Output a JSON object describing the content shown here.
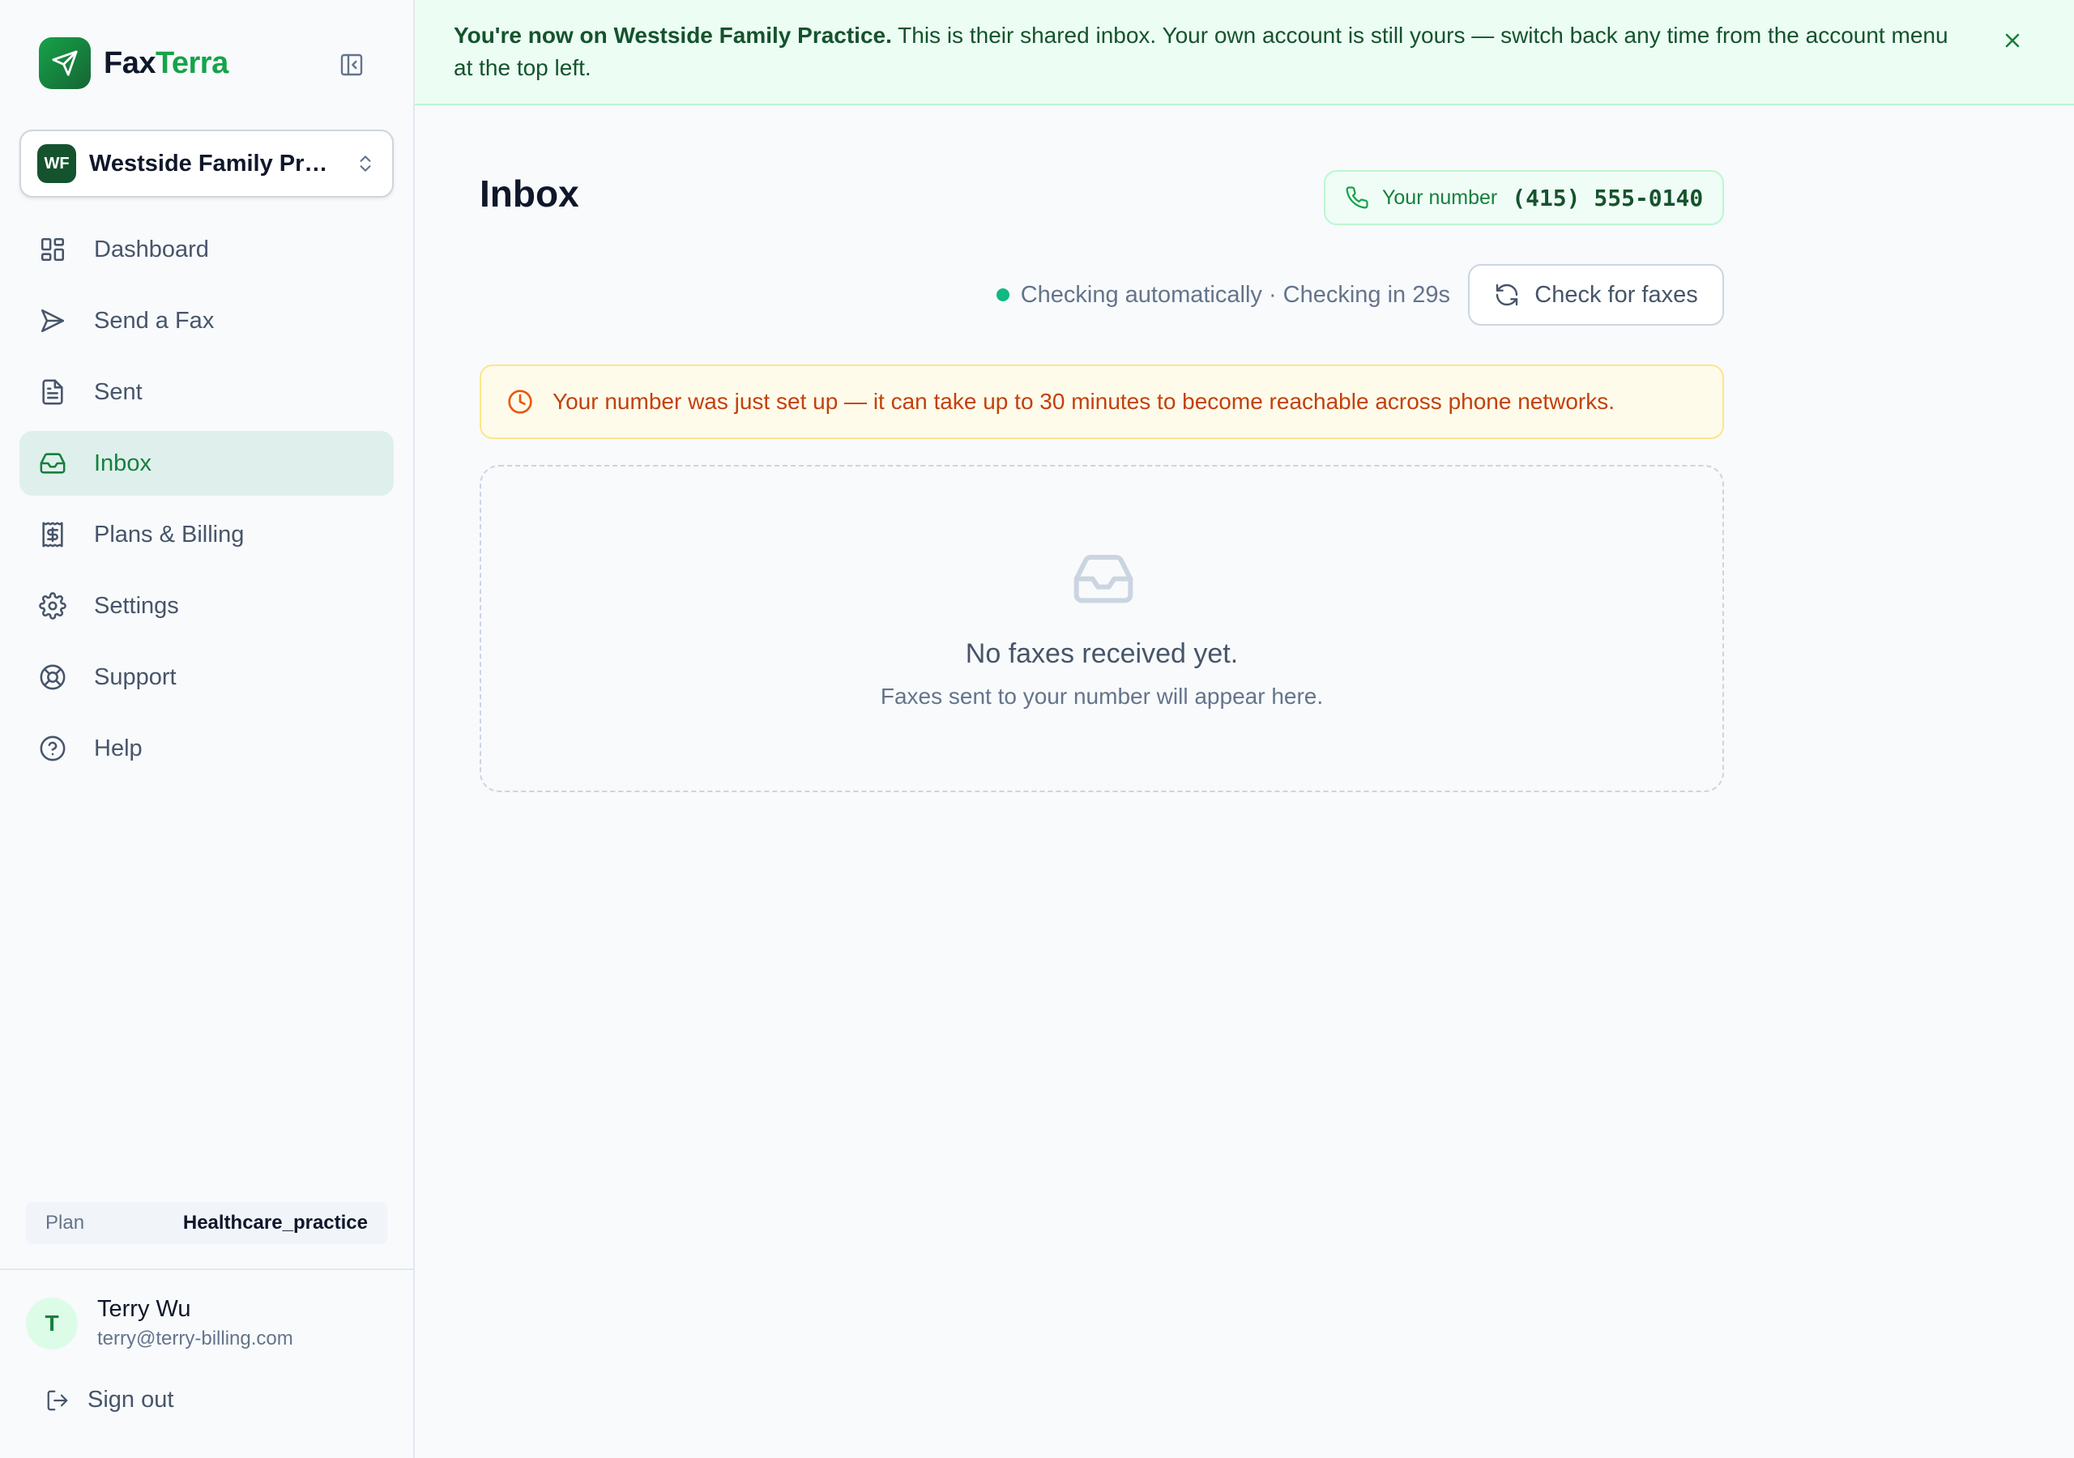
{
  "app": {
    "brand_part1": "Fax",
    "brand_part2": "Terra",
    "brand_color": "#16a34a"
  },
  "account": {
    "initials": "WF",
    "name": "Westside Family Practice"
  },
  "nav": {
    "items": [
      {
        "label": "Dashboard",
        "icon": "dashboard-icon"
      },
      {
        "label": "Send a Fax",
        "icon": "send-icon"
      },
      {
        "label": "Sent",
        "icon": "document-icon"
      },
      {
        "label": "Inbox",
        "icon": "inbox-icon",
        "active": true
      },
      {
        "label": "Plans & Billing",
        "icon": "billing-icon"
      },
      {
        "label": "Settings",
        "icon": "gear-icon"
      },
      {
        "label": "Support",
        "icon": "lifebuoy-icon"
      },
      {
        "label": "Help",
        "icon": "help-icon"
      }
    ]
  },
  "plan": {
    "label": "Plan",
    "value": "Healthcare_practice"
  },
  "user": {
    "initial": "T",
    "name": "Terry Wu",
    "email": "terry@terry-billing.com",
    "signout_label": "Sign out"
  },
  "banner": {
    "bold": "You're now on Westside Family Practice.",
    "text": " This is their shared inbox. Your own account is still yours — switch back any time from the account menu at the top left."
  },
  "main": {
    "title": "Inbox",
    "number_label": "Your number",
    "number_value": "(415) 555-0140",
    "status_text": "Checking automatically · Checking in 29s",
    "check_button": "Check for faxes",
    "notice": "Your number was just set up — it can take up to 30 minutes to become reachable across phone networks.",
    "empty_title": "No faxes received yet.",
    "empty_subtitle": "Faxes sent to your number will appear here."
  },
  "colors": {
    "accent": "#16a34a",
    "active_nav_bg": "#dff0ec",
    "banner_bg": "#ecfdf3",
    "notice_bg": "#fffbeb",
    "notice_text": "#c2410c",
    "status_dot": "#10b981"
  }
}
